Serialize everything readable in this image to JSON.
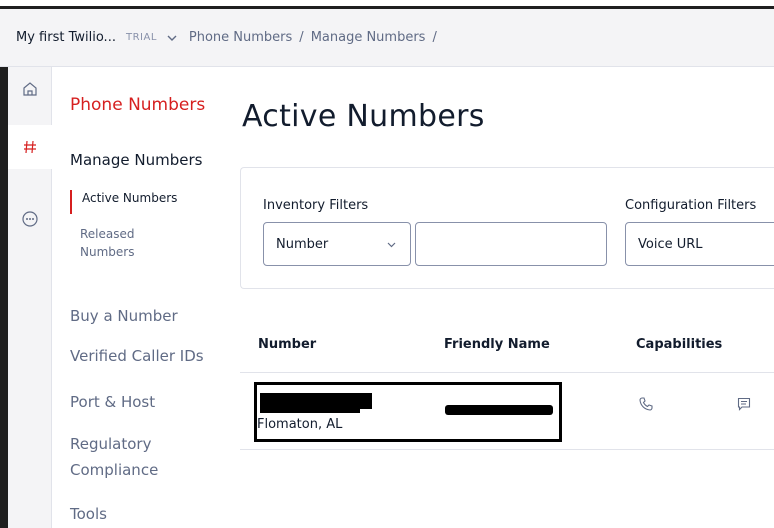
{
  "header": {
    "account": "My first Twilio...",
    "badge": "TRIAL",
    "breadcrumb": [
      "Phone Numbers",
      "Manage Numbers"
    ],
    "separator": "/"
  },
  "rail": [
    "home-icon",
    "hash-icon",
    "more-icon"
  ],
  "subnav": {
    "section": "Phone Numbers",
    "group": "Manage Numbers",
    "active_item": "Active Numbers",
    "released_item": "Released Numbers",
    "items": [
      "Buy a Number",
      "Verified Caller IDs",
      "Port & Host",
      "Regulatory Compliance",
      "Tools"
    ]
  },
  "page": {
    "title": "Active Numbers"
  },
  "filters": {
    "inventory_label": "Inventory Filters",
    "inventory_select": "Number",
    "inventory_input": "",
    "config_label": "Configuration Filters",
    "config_select": "Voice URL"
  },
  "table": {
    "columns": [
      "Number",
      "Friendly Name",
      "Capabilities"
    ],
    "rows": [
      {
        "location": "Flomaton, AL"
      }
    ]
  },
  "colors": {
    "accent": "#d61f1f",
    "text": "#121c2d",
    "muted": "#606b85",
    "border": "#e1e3ea"
  }
}
